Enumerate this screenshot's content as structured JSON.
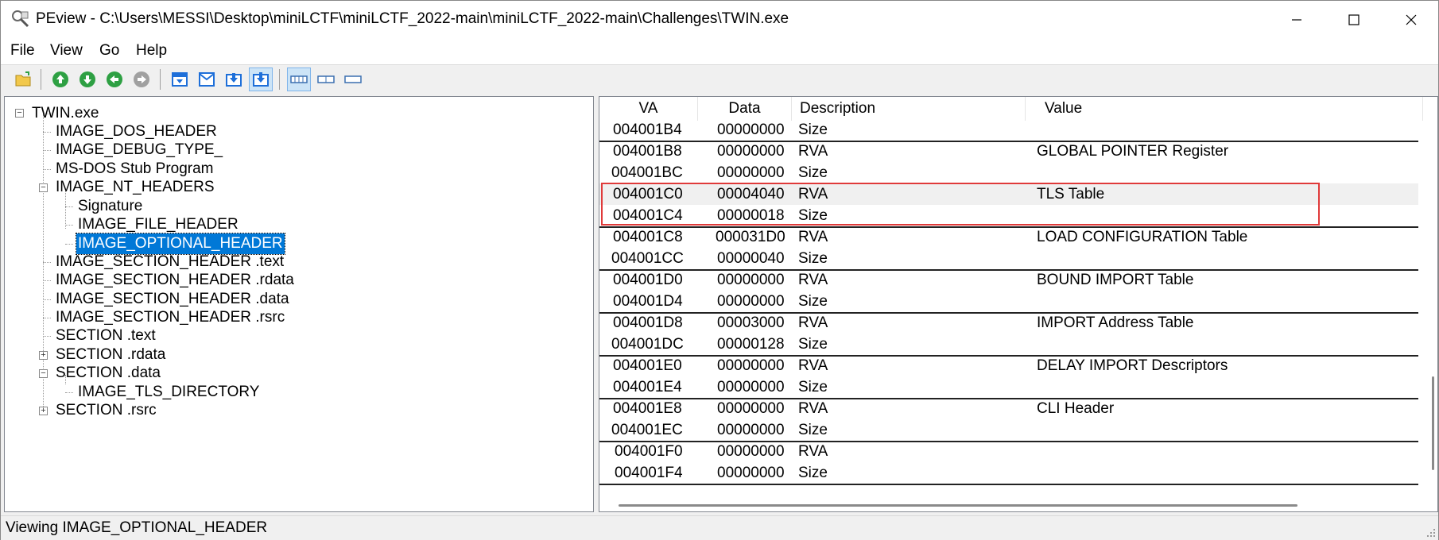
{
  "window": {
    "title": "PEview - C:\\Users\\MESSI\\Desktop\\miniLCTF\\miniLCTF_2022-main\\miniLCTF_2022-main\\Challenges\\TWIN.exe",
    "app_icon": "magnifier-icon",
    "minimize_icon": "minimize-icon",
    "maximize_icon": "maximize-icon",
    "close_icon": "close-icon"
  },
  "menu": {
    "items": [
      {
        "label": "File"
      },
      {
        "label": "View"
      },
      {
        "label": "Go"
      },
      {
        "label": "Help"
      }
    ]
  },
  "toolbar": {
    "buttons": [
      {
        "icon": "open-folder-icon"
      },
      {
        "icon": "up-arrow-icon"
      },
      {
        "icon": "down-arrow-icon"
      },
      {
        "icon": "back-arrow-icon"
      },
      {
        "icon": "forward-arrow-icon-disabled"
      },
      {
        "icon": "view-header-down-icon"
      },
      {
        "icon": "view-header-icon"
      },
      {
        "icon": "view-down-icon"
      },
      {
        "icon": "view-down-pressed-icon"
      },
      {
        "icon": "view-hex-icon"
      },
      {
        "icon": "view-split-icon"
      },
      {
        "icon": "view-single-icon"
      }
    ]
  },
  "tree": {
    "nodes": [
      {
        "label": "TWIN.exe",
        "expander": "−"
      },
      {
        "label": "IMAGE_DOS_HEADER"
      },
      {
        "label": "IMAGE_DEBUG_TYPE_"
      },
      {
        "label": "MS-DOS Stub Program"
      },
      {
        "label": "IMAGE_NT_HEADERS",
        "expander": "−"
      },
      {
        "label": "Signature"
      },
      {
        "label": "IMAGE_FILE_HEADER"
      },
      {
        "label": "IMAGE_OPTIONAL_HEADER",
        "selected": true
      },
      {
        "label": "IMAGE_SECTION_HEADER .text"
      },
      {
        "label": "IMAGE_SECTION_HEADER .rdata"
      },
      {
        "label": "IMAGE_SECTION_HEADER .data"
      },
      {
        "label": "IMAGE_SECTION_HEADER .rsrc"
      },
      {
        "label": "SECTION .text"
      },
      {
        "label": "SECTION .rdata",
        "expander": "+"
      },
      {
        "label": "SECTION .data",
        "expander": "−"
      },
      {
        "label": "IMAGE_TLS_DIRECTORY"
      },
      {
        "label": "SECTION .rsrc",
        "expander": "+"
      }
    ]
  },
  "list": {
    "columns": [
      {
        "label": "VA"
      },
      {
        "label": "Data"
      },
      {
        "label": "Description"
      },
      {
        "label": "Value"
      }
    ],
    "rows": [
      {
        "va": "004001B4",
        "data": "00000000",
        "desc": "Size",
        "value": ""
      },
      {
        "va": "004001B8",
        "data": "00000000",
        "desc": "RVA",
        "value": "GLOBAL POINTER Register"
      },
      {
        "va": "004001BC",
        "data": "00000000",
        "desc": "Size",
        "value": ""
      },
      {
        "va": "004001C0",
        "data": "00004040",
        "desc": "RVA",
        "value": "TLS Table"
      },
      {
        "va": "004001C4",
        "data": "00000018",
        "desc": "Size",
        "value": ""
      },
      {
        "va": "004001C8",
        "data": "000031D0",
        "desc": "RVA",
        "value": "LOAD CONFIGURATION Table"
      },
      {
        "va": "004001CC",
        "data": "00000040",
        "desc": "Size",
        "value": ""
      },
      {
        "va": "004001D0",
        "data": "00000000",
        "desc": "RVA",
        "value": "BOUND IMPORT Table"
      },
      {
        "va": "004001D4",
        "data": "00000000",
        "desc": "Size",
        "value": ""
      },
      {
        "va": "004001D8",
        "data": "00003000",
        "desc": "RVA",
        "value": "IMPORT Address Table"
      },
      {
        "va": "004001DC",
        "data": "00000128",
        "desc": "Size",
        "value": ""
      },
      {
        "va": "004001E0",
        "data": "00000000",
        "desc": "RVA",
        "value": "DELAY IMPORT Descriptors"
      },
      {
        "va": "004001E4",
        "data": "00000000",
        "desc": "Size",
        "value": ""
      },
      {
        "va": "004001E8",
        "data": "00000000",
        "desc": "RVA",
        "value": "CLI Header"
      },
      {
        "va": "004001EC",
        "data": "00000000",
        "desc": "Size",
        "value": ""
      },
      {
        "va": "004001F0",
        "data": "00000000",
        "desc": "RVA",
        "value": ""
      },
      {
        "va": "004001F4",
        "data": "00000000",
        "desc": "Size",
        "value": ""
      }
    ],
    "highlight_color": "#e03a3a"
  },
  "status": {
    "text": "Viewing IMAGE_OPTIONAL_HEADER"
  },
  "colors": {
    "selection": "#0078d7",
    "toolbar_green": "#2ea043",
    "toolbar_blue": "#1e6fd9"
  }
}
